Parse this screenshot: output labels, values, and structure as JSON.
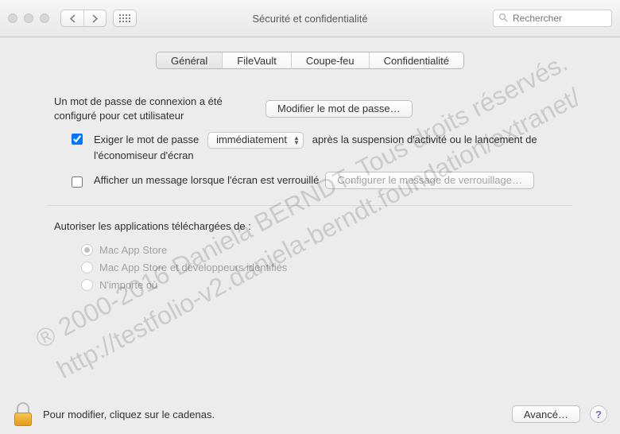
{
  "toolbar": {
    "title": "Sécurité et confidentialité",
    "search_placeholder": "Rechercher"
  },
  "tabs": {
    "general": "Général",
    "filevault": "FileVault",
    "firewall": "Coupe-feu",
    "privacy": "Confidentialité"
  },
  "general": {
    "password_set_label": "Un mot de passe de connexion a été configuré pour cet utilisateur",
    "change_password_btn": "Modifier le mot de passe…",
    "require_password_label": "Exiger le mot de passe",
    "require_password_delay": "immédiatement",
    "require_password_after": "après la suspension d'activité ou le lancement de l'économiseur d'écran",
    "show_lock_message_label": "Afficher un message lorsque l'écran est verrouillé",
    "set_lock_message_btn": "Configurer le message de verrouillage…"
  },
  "gatekeeper": {
    "title": "Autoriser les applications téléchargées de :",
    "opt_mas": "Mac App Store",
    "opt_mas_dev": "Mac App Store et développeurs identifiés",
    "opt_anywhere": "N'importe où"
  },
  "footer": {
    "lock_hint": "Pour modifier, cliquez sur le cadenas.",
    "advanced_btn": "Avancé…",
    "help": "?"
  },
  "watermark": {
    "line1": "® 2000-2016 Daniela BERNDT. Tous droits réservés.",
    "line2": "http://testfolio-v2.daniela-berndt.foundation/extranet/"
  }
}
